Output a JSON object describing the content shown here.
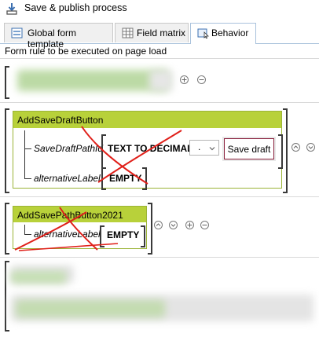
{
  "toolbar": {
    "save_publish_label": "Save & publish process",
    "icon": "save-publish-icon"
  },
  "tabs": [
    {
      "label": "Global form template",
      "icon": "form-template-icon",
      "active": false
    },
    {
      "label": "Field matrix",
      "icon": "grid-icon",
      "active": false
    },
    {
      "label": "Behavior",
      "icon": "behavior-icon",
      "active": true
    }
  ],
  "subtitle": "Form rule to be executed on page load",
  "rules": [
    {
      "name": "AddSaveDraftButton",
      "params": [
        {
          "label": "SaveDraftPathId",
          "value": "TEXT TO DECIMAL",
          "select_value": ".",
          "button_label": "Save draft"
        },
        {
          "label": "alternativeLabel",
          "value": "EMPTY"
        }
      ]
    },
    {
      "name": "AddSavePathButton2021",
      "params": [
        {
          "label": "alternativeLabel",
          "value": "EMPTY"
        }
      ]
    }
  ],
  "colors": {
    "rule_header": "#b8d13a",
    "rule_border": "#9bb437",
    "tab_border": "#a9c2dc",
    "annotation_red": "#e0201a",
    "save_button_border": "#8a1f3c"
  }
}
